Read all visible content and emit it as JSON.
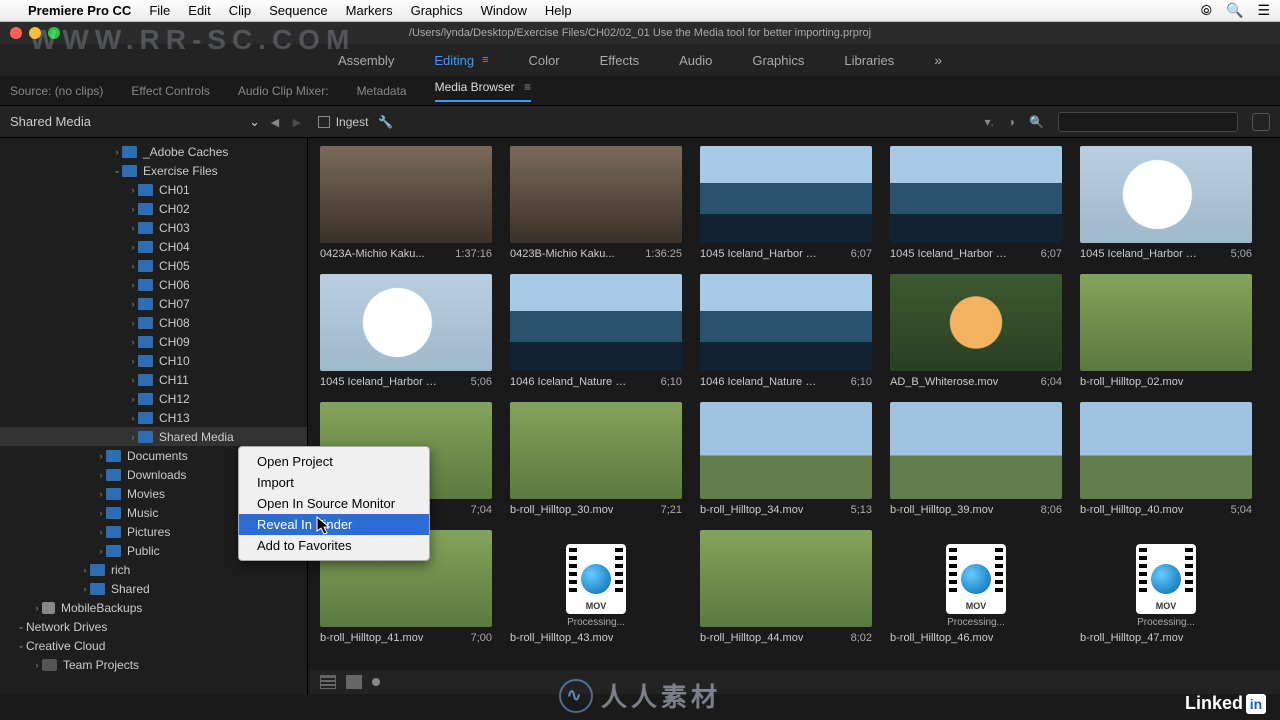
{
  "menubar": {
    "app": "Premiere Pro CC",
    "items": [
      "File",
      "Edit",
      "Clip",
      "Sequence",
      "Markers",
      "Graphics",
      "Window",
      "Help"
    ]
  },
  "window": {
    "title": "/Users/lynda/Desktop/Exercise Files/CH02/02_01 Use the Media tool for better importing.prproj"
  },
  "workspace": {
    "tabs": [
      "Assembly",
      "Editing",
      "Color",
      "Effects",
      "Audio",
      "Graphics",
      "Libraries"
    ],
    "active": "Editing"
  },
  "panels": {
    "tabs": [
      "Source: (no clips)",
      "Effect Controls",
      "Audio Clip Mixer:",
      "Metadata",
      "Media Browser"
    ],
    "active": "Media Browser"
  },
  "toolbar": {
    "source": "Shared Media",
    "ingest": "Ingest"
  },
  "tree": {
    "rows": [
      {
        "indent": 7,
        "disc": "›",
        "type": "folder",
        "label": "_Adobe Caches"
      },
      {
        "indent": 7,
        "disc": "⌄",
        "type": "folder",
        "label": "Exercise Files"
      },
      {
        "indent": 8,
        "disc": "›",
        "type": "folder",
        "label": "CH01"
      },
      {
        "indent": 8,
        "disc": "›",
        "type": "folder",
        "label": "CH02"
      },
      {
        "indent": 8,
        "disc": "›",
        "type": "folder",
        "label": "CH03"
      },
      {
        "indent": 8,
        "disc": "›",
        "type": "folder",
        "label": "CH04"
      },
      {
        "indent": 8,
        "disc": "›",
        "type": "folder",
        "label": "CH05"
      },
      {
        "indent": 8,
        "disc": "›",
        "type": "folder",
        "label": "CH06"
      },
      {
        "indent": 8,
        "disc": "›",
        "type": "folder",
        "label": "CH07"
      },
      {
        "indent": 8,
        "disc": "›",
        "type": "folder",
        "label": "CH08"
      },
      {
        "indent": 8,
        "disc": "›",
        "type": "folder",
        "label": "CH09"
      },
      {
        "indent": 8,
        "disc": "›",
        "type": "folder",
        "label": "CH10"
      },
      {
        "indent": 8,
        "disc": "›",
        "type": "folder",
        "label": "CH11"
      },
      {
        "indent": 8,
        "disc": "›",
        "type": "folder",
        "label": "CH12"
      },
      {
        "indent": 8,
        "disc": "›",
        "type": "folder",
        "label": "CH13"
      },
      {
        "indent": 8,
        "disc": "›",
        "type": "folder",
        "label": "Shared Media",
        "sel": true
      },
      {
        "indent": 6,
        "disc": "›",
        "type": "folder",
        "label": "Documents"
      },
      {
        "indent": 6,
        "disc": "›",
        "type": "folder",
        "label": "Downloads"
      },
      {
        "indent": 6,
        "disc": "›",
        "type": "folder",
        "label": "Movies"
      },
      {
        "indent": 6,
        "disc": "›",
        "type": "folder",
        "label": "Music"
      },
      {
        "indent": 6,
        "disc": "›",
        "type": "folder",
        "label": "Pictures"
      },
      {
        "indent": 6,
        "disc": "›",
        "type": "folder",
        "label": "Public"
      },
      {
        "indent": 5,
        "disc": "›",
        "type": "folder",
        "label": "rich"
      },
      {
        "indent": 5,
        "disc": "›",
        "type": "folder",
        "label": "Shared"
      },
      {
        "indent": 2,
        "disc": "›",
        "type": "disk",
        "label": "MobileBackups"
      },
      {
        "indent": 1,
        "disc": "⌄",
        "type": "none",
        "label": "Network Drives"
      },
      {
        "indent": 1,
        "disc": "⌄",
        "type": "none",
        "label": "Creative Cloud"
      },
      {
        "indent": 2,
        "disc": "›",
        "type": "db",
        "label": "Team Projects"
      }
    ]
  },
  "clips": [
    {
      "name": "0423A-Michio Kaku...",
      "dur": "1:37:16",
      "cls": "indoor"
    },
    {
      "name": "0423B-Michio Kaku...",
      "dur": "1:36:25",
      "cls": "indoor"
    },
    {
      "name": "1045 Iceland_Harbor Sc...",
      "dur": "6;07",
      "cls": "sea"
    },
    {
      "name": "1045 Iceland_Harbor S...",
      "dur": "6;07",
      "cls": "sea"
    },
    {
      "name": "1045 Iceland_Harbor Sc...",
      "dur": "5;06",
      "cls": "seagull"
    },
    {
      "name": "1045 Iceland_Harbor S...",
      "dur": "5;06",
      "cls": "seagull"
    },
    {
      "name": "1046 Iceland_Nature Sc...",
      "dur": "6;10",
      "cls": "sea"
    },
    {
      "name": "1046 Iceland_Nature Sc...",
      "dur": "6;10",
      "cls": "sea"
    },
    {
      "name": "AD_B_Whiterose.mov",
      "dur": "6;04",
      "cls": "rose"
    },
    {
      "name": "b-roll_Hilltop_02.mov",
      "dur": "",
      "cls": "olive"
    },
    {
      "name": "",
      "dur": "7;04",
      "cls": "olive",
      "partial": true
    },
    {
      "name": "b-roll_Hilltop_30.mov",
      "dur": "7;21",
      "cls": "olive"
    },
    {
      "name": "b-roll_Hilltop_34.mov",
      "dur": "5;13",
      "cls": "hill"
    },
    {
      "name": "b-roll_Hilltop_39.mov",
      "dur": "8;06",
      "cls": "hill"
    },
    {
      "name": "b-roll_Hilltop_40.mov",
      "dur": "5;04",
      "cls": "hill"
    },
    {
      "name": "b-roll_Hilltop_41.mov",
      "dur": "7;00",
      "cls": "olive"
    },
    {
      "name": "b-roll_Hilltop_43.mov",
      "dur": "",
      "cls": "mov",
      "proc": "Processing..."
    },
    {
      "name": "b-roll_Hilltop_44.mov",
      "dur": "8;02",
      "cls": "olive"
    },
    {
      "name": "b-roll_Hilltop_46.mov",
      "dur": "",
      "cls": "mov",
      "proc": "Processing..."
    },
    {
      "name": "b-roll_Hilltop_47.mov",
      "dur": "",
      "cls": "mov",
      "proc": "Processing..."
    }
  ],
  "context_menu": {
    "items": [
      "Open Project",
      "Import",
      "Open In Source Monitor",
      "Reveal In Finder",
      "Add to Favorites"
    ],
    "selected": "Reveal In Finder"
  },
  "mov_label": "MOV",
  "watermark": {
    "text": "人人素材"
  },
  "linkedin": {
    "text": "Linked"
  }
}
